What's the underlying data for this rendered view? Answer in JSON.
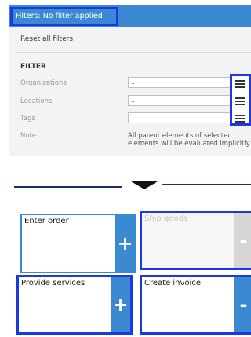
{
  "header": {
    "title": "Filters: No filter applied"
  },
  "filter_panel": {
    "reset_label": "Reset all filters",
    "heading": "FILTER",
    "rows": [
      {
        "label": "Organizations",
        "value": "..."
      },
      {
        "label": "Locations",
        "value": "..."
      },
      {
        "label": "Tags",
        "value": "..."
      }
    ],
    "note_label": "Note",
    "note_text": "All parent elements of selected elements will be evaluated implicitly.",
    "menu_icon": "hamburger-menu-icon"
  },
  "divider": {
    "icon": "down-arrow-icon"
  },
  "tiles": [
    {
      "label": "Enter order",
      "action": "+",
      "disabled": false
    },
    {
      "label": "Ship goods",
      "action": "-",
      "disabled": true
    },
    {
      "label": "Provide services",
      "action": "+",
      "disabled": false
    },
    {
      "label": "Create invoice",
      "action": "-",
      "disabled": false
    }
  ],
  "colors": {
    "accent": "#3b8ad1",
    "highlight": "#1a39e6",
    "panel": "#f3f3f3"
  }
}
